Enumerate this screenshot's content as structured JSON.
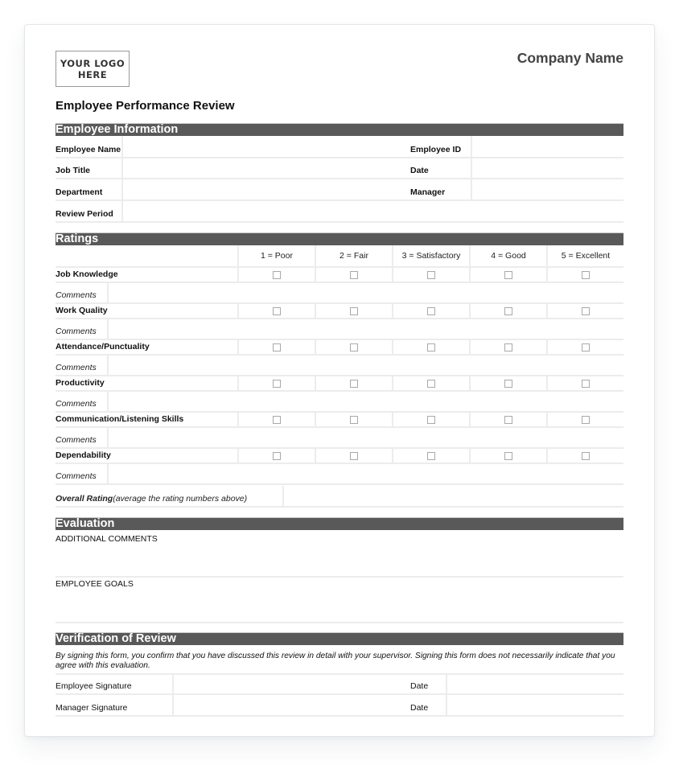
{
  "header": {
    "logo_text": "YOUR LOGO\nHERE",
    "company_name": "Company Name",
    "title": "Employee Performance Review"
  },
  "sections": {
    "employee_info": "Employee Information",
    "ratings": "Ratings",
    "evaluation": "Evaluation",
    "verification": "Verification of Review"
  },
  "employee_info": {
    "fields": [
      {
        "label": "Employee Name",
        "value": ""
      },
      {
        "label": "Job Title",
        "value": ""
      },
      {
        "label": "Department",
        "value": ""
      },
      {
        "label": "Review Period",
        "value": ""
      }
    ],
    "right_fields": [
      {
        "label": "Employee ID",
        "value": ""
      },
      {
        "label": "Date",
        "value": ""
      },
      {
        "label": "Manager",
        "value": ""
      }
    ]
  },
  "ratings": {
    "scale": [
      "1 = Poor",
      "2 = Fair",
      "3 = Satisfactory",
      "4 = Good",
      "5 = Excellent"
    ],
    "comments_label": "Comments",
    "criteria": [
      {
        "label": "Job Knowledge",
        "checked": [
          false,
          false,
          false,
          false,
          false
        ],
        "comments": ""
      },
      {
        "label": "Work Quality",
        "checked": [
          false,
          false,
          false,
          false,
          false
        ],
        "comments": ""
      },
      {
        "label": "Attendance/Punctuality",
        "checked": [
          false,
          false,
          false,
          false,
          false
        ],
        "comments": ""
      },
      {
        "label": "Productivity",
        "checked": [
          false,
          false,
          false,
          false,
          false
        ],
        "comments": ""
      },
      {
        "label": "Communication/Listening Skills",
        "checked": [
          false,
          false,
          false,
          false,
          false
        ],
        "comments": ""
      },
      {
        "label": "Dependability",
        "checked": [
          false,
          false,
          false,
          false,
          false
        ],
        "comments": ""
      }
    ],
    "overall_label": "Overall Rating",
    "overall_hint": " (average the rating numbers above)",
    "overall_value": ""
  },
  "evaluation": {
    "additional_comments_label": "ADDITIONAL COMMENTS",
    "additional_comments_value": "",
    "employee_goals_label": "EMPLOYEE GOALS",
    "employee_goals_value": ""
  },
  "verification": {
    "statement": "By signing this form, you confirm that you have discussed this review in detail with your supervisor. Signing this form does not necessarily indicate that you agree with this evaluation.",
    "signatures": [
      {
        "label": "Employee Signature",
        "date_label": "Date",
        "value": "",
        "date_value": ""
      },
      {
        "label": "Manager Signature",
        "date_label": "Date",
        "value": "",
        "date_value": ""
      }
    ]
  }
}
